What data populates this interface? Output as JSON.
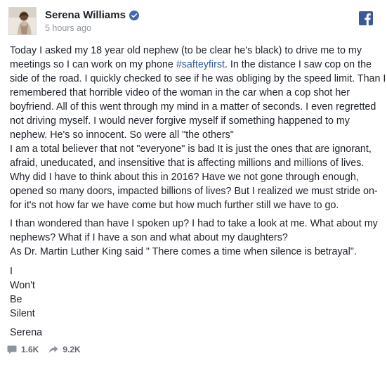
{
  "post": {
    "author": "Serena Williams",
    "time": "5 hours ago",
    "paragraph1": {
      "lines": [
        "Today I asked my 18 year old nephew (to be clear he's black) to drive me to my",
        "meetings so I can work on my phone ",
        "side of the road. I quickly checked to see if he was obliging by the speed limit. Than I",
        "remembered that horrible video of the woman in the car when a cop shot her",
        "boyfriend. All of this went through my mind in a matter of seconds. I even regretted",
        "not driving myself. I would never forgive myself if something happened to my",
        "nephew. He's so innocent. So were all \"the others\"",
        "I am a total believer that not \"everyone\" is bad It is just the ones that are ignorant,",
        "afraid, uneducated, and insensitive that is affecting millions and millions of lives.",
        "Why did I have to think about this in 2016? Have we not gone through enough,",
        "opened so many doors, impacted billions of lives? But I realized we must stride on-",
        "for it's not how far we have come but how much further still we have to go."
      ],
      "hashtag": "#safteyfirst",
      "after_hashtag": ". In the distance I saw cop on the"
    },
    "paragraph2": {
      "lines": [
        "I than wondered than have I spoken up? I had to take a look at me. What about my",
        "nephews? What if I have a son and what about my daughters?",
        "As Dr. Martin Luther King said \" There comes a time when silence is betrayal\"."
      ]
    },
    "signoff": [
      "I",
      "Won't",
      "Be",
      "Silent"
    ],
    "signature": "Serena"
  },
  "footer": {
    "comments": "1.6K",
    "shares": "9.2K"
  },
  "icons": {
    "verified": "verified-badge-icon",
    "facebook": "facebook-logo-icon",
    "comment": "comment-icon",
    "share": "share-icon"
  },
  "colors": {
    "text": "#1d2129",
    "meta": "#90949c",
    "link": "#365899",
    "verified_blue": "#4267b2",
    "facebook_blue": "#3b5998"
  }
}
